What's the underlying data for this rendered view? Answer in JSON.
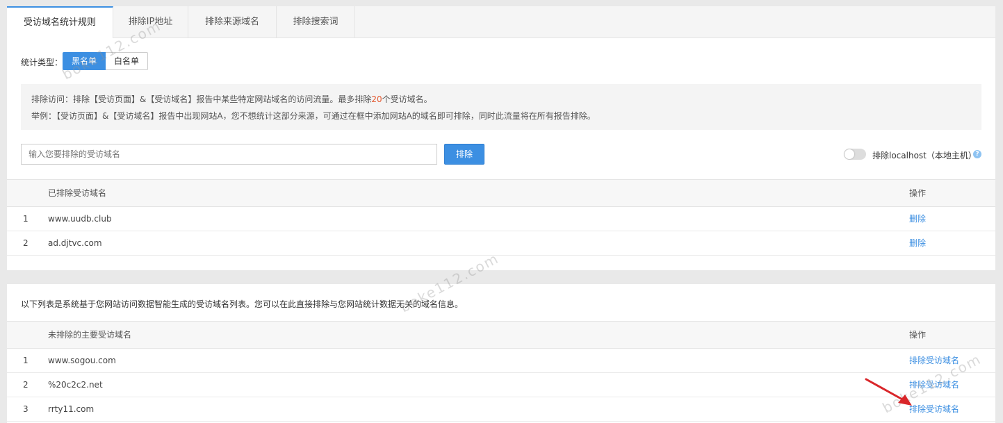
{
  "tabs": [
    {
      "label": "受访域名统计规则",
      "active": true
    },
    {
      "label": "排除IP地址",
      "active": false
    },
    {
      "label": "排除来源域名",
      "active": false
    },
    {
      "label": "排除搜索词",
      "active": false
    }
  ],
  "stat_type": {
    "label": "统计类型：",
    "options": [
      "黑名单",
      "白名单"
    ],
    "selected": "黑名单"
  },
  "notice": {
    "line1_prefix": "排除访问：排除【受访页面】&【受访域名】报告中某些特定网站域名的访问流量。最多排除",
    "line1_count": "20",
    "line1_suffix": "个受访域名。",
    "line2": "举例：【受访页面】&【受访域名】报告中出现网站A，您不想统计这部分来源，可通过在框中添加网站A的域名即可排除，同时此流量将在所有报告排除。"
  },
  "input": {
    "placeholder": "输入您要排除的受访域名",
    "value": ""
  },
  "exclude_button": "排除",
  "localhost_toggle": {
    "label": "排除localhost（本地主机）",
    "on": false
  },
  "excluded_table": {
    "columns": [
      "",
      "已排除受访域名",
      "操作"
    ],
    "rows": [
      {
        "index": "1",
        "domain": "www.uudb.club",
        "action": "删除"
      },
      {
        "index": "2",
        "domain": "ad.djtvc.com",
        "action": "删除"
      }
    ]
  },
  "suggest_text": "以下列表是系统基于您网站访问数据智能生成的受访域名列表。您可以在此直接排除与您网站统计数据无关的域名信息。",
  "suggest_table": {
    "columns": [
      "",
      "未排除的主要受访域名",
      "操作"
    ],
    "rows": [
      {
        "index": "1",
        "domain": "www.sogou.com",
        "action": "排除受访域名"
      },
      {
        "index": "2",
        "domain": "%20c2c2.net",
        "action": "排除受访域名"
      },
      {
        "index": "3",
        "domain": "rrty11.com",
        "action": "排除受访域名"
      }
    ]
  },
  "watermarks": [
    "boke112.com",
    "boke112.com",
    "boke112.com"
  ],
  "colors": {
    "accent": "#3c8fe2",
    "highlight": "#e4572e",
    "arrow": "#d9262a"
  }
}
